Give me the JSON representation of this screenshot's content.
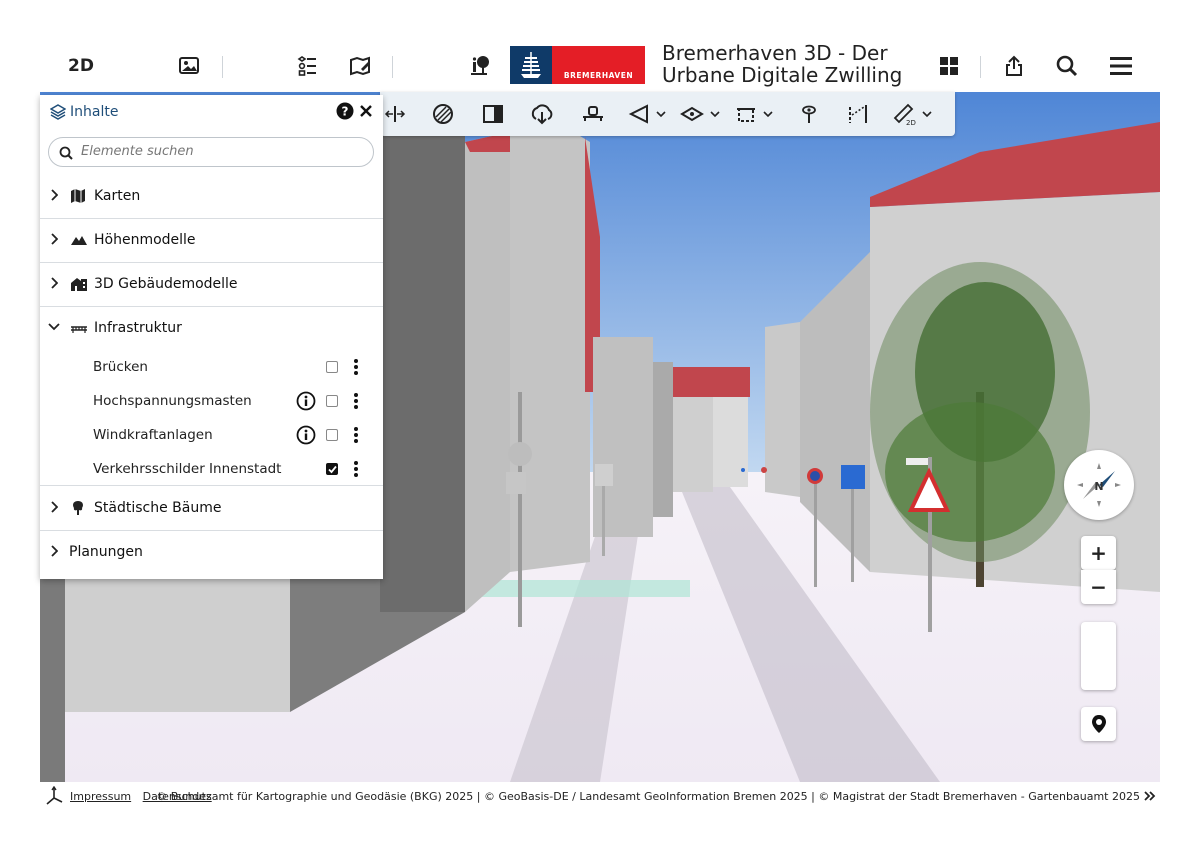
{
  "header": {
    "mode_label": "2D",
    "title_line1": "Bremerhaven 3D - Der",
    "title_line2": "Urbane Digitale Zwilling",
    "logo_text": "BREMERHAVEN",
    "icons": [
      "image-icon",
      "legend-list-icon",
      "map-style-icon",
      "feature-info-icon",
      "apps-grid-icon",
      "share-icon",
      "search-icon",
      "menu-icon"
    ]
  },
  "toolbar": {
    "icons": [
      "split-view-icon",
      "shadow-icon",
      "panel-layout-icon",
      "download-icon",
      "drone-icon",
      "viewshed-icon",
      "perspective-icon",
      "clip-box-icon",
      "visibility-icon",
      "measure-height-icon",
      "measure-2d-icon"
    ]
  },
  "panel": {
    "title": "Inhalte",
    "search_placeholder": "Elemente suchen",
    "categories": [
      {
        "label": "Karten",
        "icon": "map-icon",
        "expanded": false
      },
      {
        "label": "Höhenmodelle",
        "icon": "mountain-icon",
        "expanded": false
      },
      {
        "label": "3D Gebäudemodelle",
        "icon": "building-icon",
        "expanded": false
      },
      {
        "label": "Infrastruktur",
        "icon": "bridge-icon",
        "expanded": true
      },
      {
        "label": "Städtische Bäume",
        "icon": "tree-icon",
        "expanded": false
      },
      {
        "label": "Planungen",
        "icon": "",
        "expanded": false
      }
    ],
    "infrastruktur_items": [
      {
        "label": "Brücken",
        "info": false,
        "checked": false
      },
      {
        "label": "Hochspannungsmasten",
        "info": true,
        "checked": false
      },
      {
        "label": "Windkraftanlagen",
        "info": true,
        "checked": false
      },
      {
        "label": "Verkehrsschilder Innenstadt",
        "info": false,
        "checked": true
      }
    ]
  },
  "map_controls": {
    "compass_label": "N",
    "zoom_in": "+",
    "zoom_out": "−"
  },
  "footer": {
    "impressum": "Impressum",
    "datenschutz": "Datenschutz",
    "copyright": "© Bundesamt für Kartographie und Geodäsie (BKG) 2025 | © GeoBasis-DE / Landesamt GeoInformation Bremen 2025 | © Magistrat der Stadt Bremerhaven - Gartenbauamt 2025"
  },
  "colors": {
    "sky": "#5b8fd8",
    "roof": "#c1464d",
    "building": "#bdbdbd",
    "ground": "#f3eef6",
    "brand_blue": "#0f3a68",
    "brand_red": "#e41e26"
  }
}
